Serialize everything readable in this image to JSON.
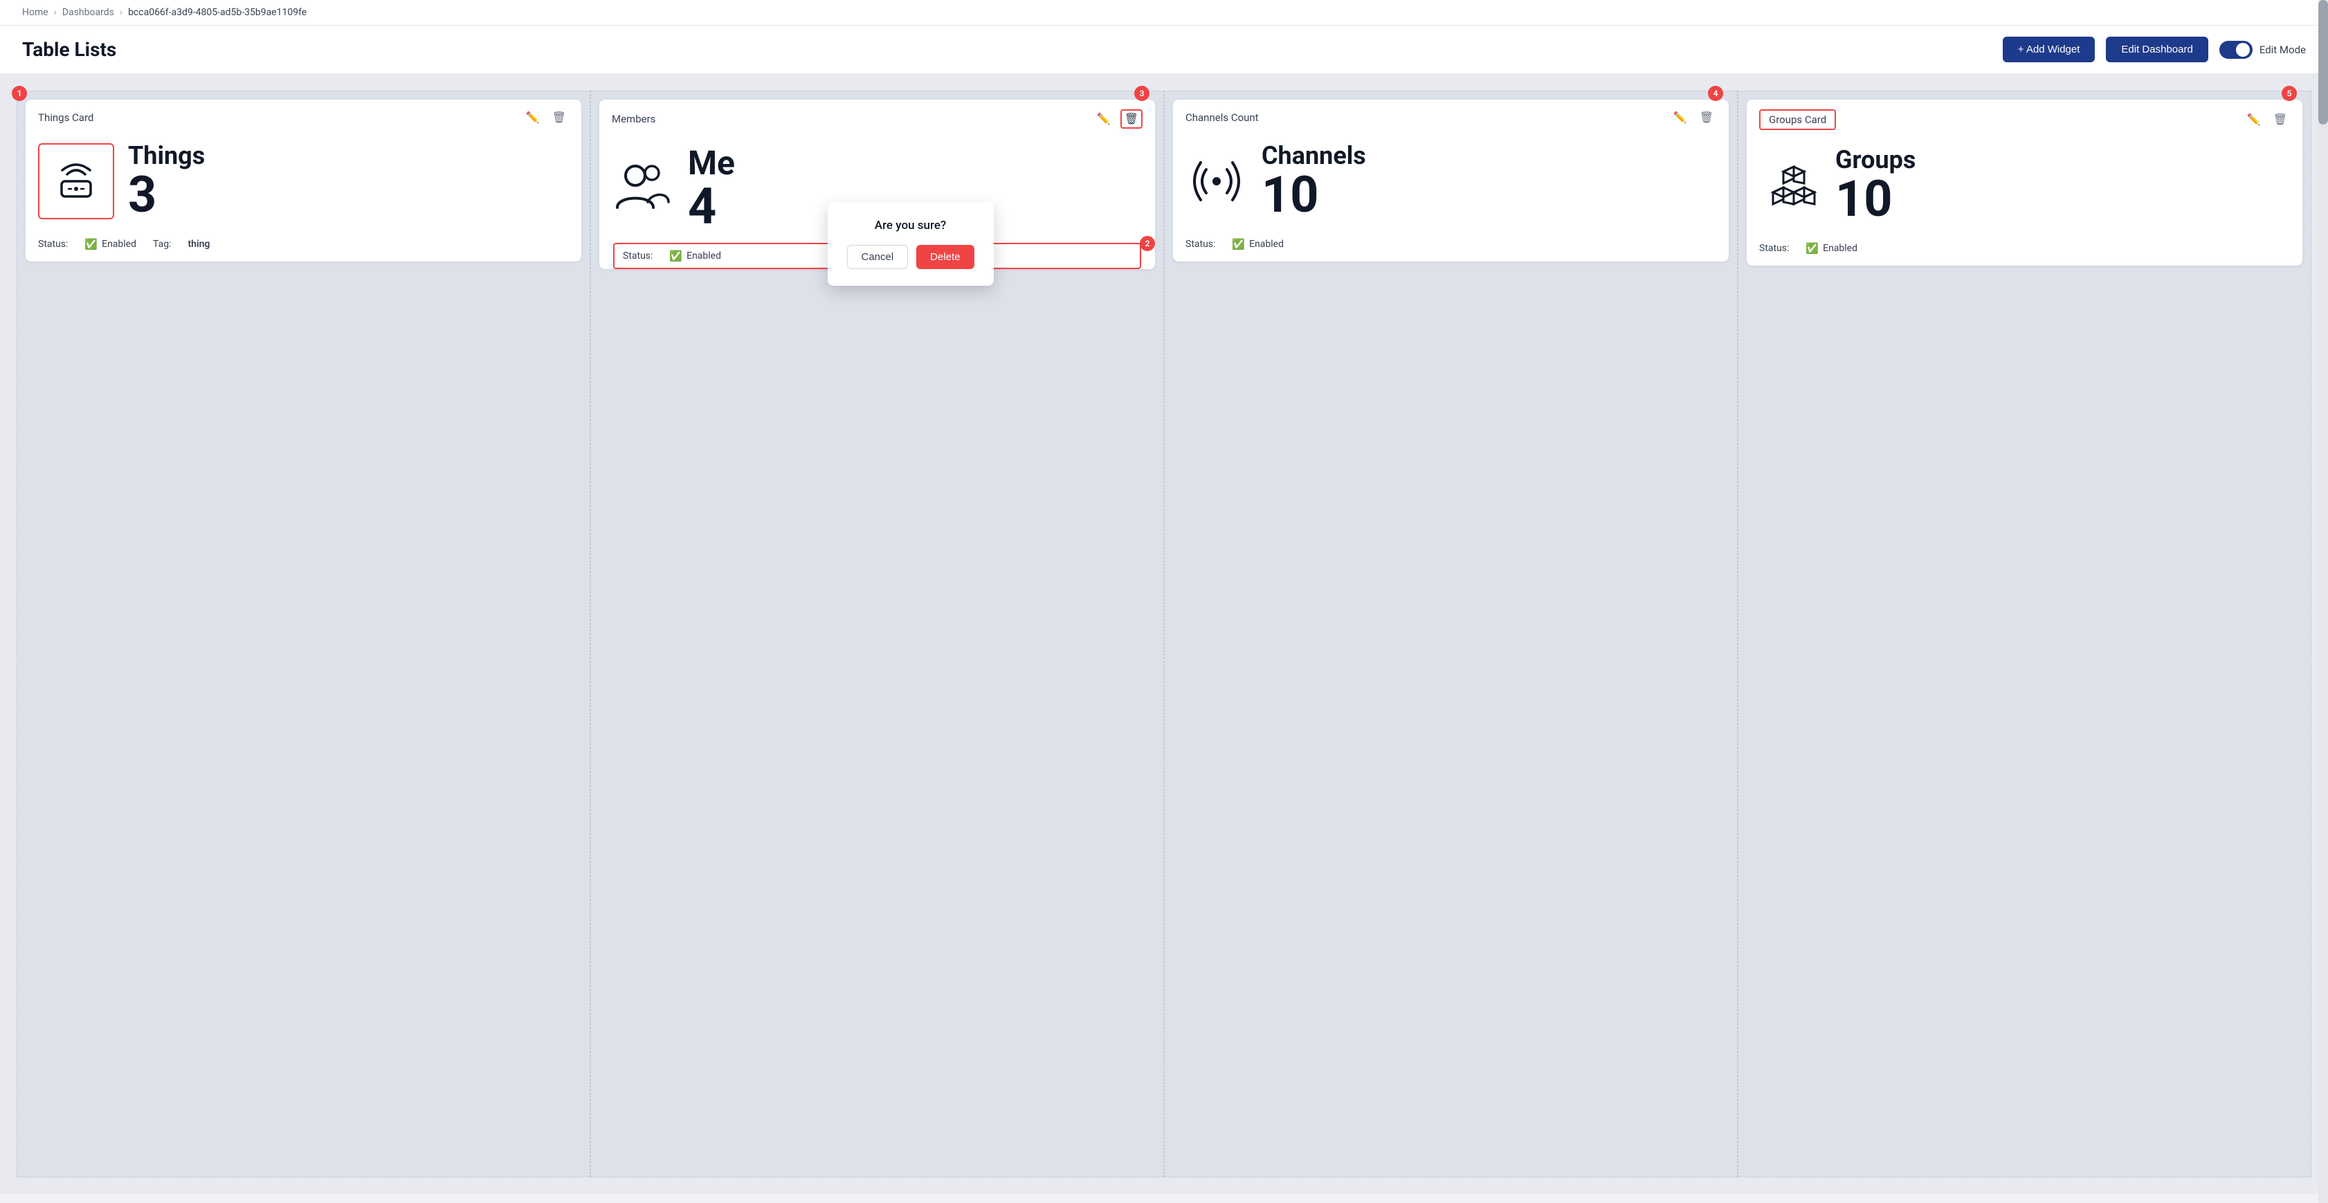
{
  "breadcrumb": {
    "home": "Home",
    "dashboards": "Dashboards",
    "dashboard_id": "bcca066f-a3d9-4805-ad5b-35b9ae1109fe"
  },
  "page": {
    "title": "Table Lists"
  },
  "header": {
    "add_widget_label": "+ Add Widget",
    "edit_dashboard_label": "Edit Dashboard",
    "edit_mode_label": "Edit Mode"
  },
  "confirm_popup": {
    "title": "Are you sure?",
    "cancel_label": "Cancel",
    "delete_label": "Delete"
  },
  "widgets": [
    {
      "id": "things-card",
      "title": "Things Card",
      "badge": "1",
      "badge_position": "top-left",
      "icon": "router",
      "stat_label": "Things",
      "stat_value": "3",
      "footer_status": "Enabled",
      "footer_tag": "thing",
      "highlighted_icon": true,
      "highlighted_footer": false
    },
    {
      "id": "members-card",
      "title": "Members",
      "badge": "3",
      "badge_position": "top-right-delete",
      "badge2": "2",
      "badge2_position": "bottom-left",
      "icon": "users",
      "stat_label": "Me",
      "stat_value": "4",
      "footer_status": "Enabled",
      "footer_tag": null,
      "highlighted_icon": false,
      "highlighted_footer": true,
      "delete_active": true
    },
    {
      "id": "channels-card",
      "title": "Channels Count",
      "badge": "4",
      "badge_position": "top-right-delete",
      "icon": "channels",
      "stat_label": "Channels",
      "stat_value": "10",
      "footer_status": "Enabled",
      "footer_tag": null,
      "highlighted_icon": false,
      "highlighted_footer": false
    },
    {
      "id": "groups-card",
      "title": "Groups Card",
      "badge": "5",
      "badge_position": "top-right",
      "icon": "groups",
      "stat_label": "Groups",
      "stat_value": "10",
      "footer_status": "Enabled",
      "footer_tag": null,
      "highlighted_icon": false,
      "highlighted_footer": false,
      "title_highlighted": true
    }
  ],
  "colors": {
    "accent_blue": "#1e3a8a",
    "red": "#ef4444",
    "green": "#10b981",
    "text_dark": "#111827",
    "text_gray": "#6b7280"
  }
}
